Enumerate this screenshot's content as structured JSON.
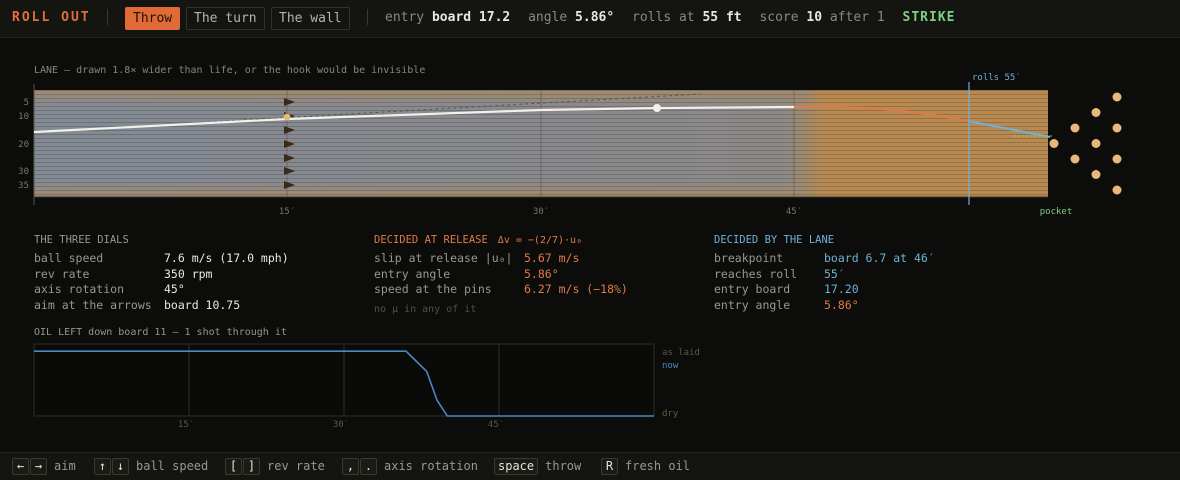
{
  "app": {
    "title": "ROLL OUT"
  },
  "tabs": [
    {
      "label": "Throw",
      "active": true
    },
    {
      "label": "The turn",
      "active": false
    },
    {
      "label": "The wall",
      "active": false
    }
  ],
  "status": {
    "entry_label": "entry",
    "entry_board": "board 17.2",
    "angle_label": "angle",
    "angle": "5.86°",
    "rolls_label": "rolls at",
    "rolls_at": "55 ft",
    "score_label": "score",
    "score": "10",
    "after": "after 1",
    "result": "STRIKE"
  },
  "lane": {
    "caption": "LANE — drawn 1.8× wider than life, or the hook would be invisible",
    "rolls_marker": "rolls  55′",
    "pocket_label": "pocket",
    "board_ticks": [
      "5",
      "10",
      "20",
      "30",
      "35"
    ],
    "ft_ticks": [
      "15′",
      "30′",
      "45′"
    ],
    "colors": {
      "oil": "#7a8aa0",
      "dry": "#b88a52",
      "skid": "#ffffff",
      "hook": "#e07a4a",
      "roll": "#6fb1d8",
      "pins": "#e8b77a"
    }
  },
  "dials": {
    "title": "THE THREE DIALS",
    "rows": [
      {
        "label": "ball speed",
        "value": "7.6 m/s  (17.0 mph)"
      },
      {
        "label": "rev rate",
        "value": "350 rpm"
      },
      {
        "label": "axis rotation",
        "value": "45°"
      },
      {
        "label": "aim at the arrows",
        "value": "board 10.75"
      }
    ]
  },
  "release": {
    "title": "DECIDED AT RELEASE",
    "formula": "Δv = −(2/7)·u₀",
    "rows": [
      {
        "label": "slip at release |u₀|",
        "value": "5.67 m/s"
      },
      {
        "label": "entry angle",
        "value": "5.86°"
      },
      {
        "label": "speed at the pins",
        "value": "6.27 m/s  (−18%)"
      }
    ],
    "note": "no μ in any of it"
  },
  "lane_decided": {
    "title": "DECIDED BY THE LANE",
    "rows": [
      {
        "label": "breakpoint",
        "value": "board 6.7 at 46′"
      },
      {
        "label": "reaches roll",
        "value": "55′"
      },
      {
        "label": "entry board",
        "value": "17.20"
      },
      {
        "label": "entry angle",
        "value": "5.86°"
      }
    ]
  },
  "oil": {
    "caption": "OIL LEFT down board 11 — 1 shot through it",
    "labels": {
      "as_laid": "as laid",
      "now": "now",
      "dry": "dry"
    },
    "ft_ticks": [
      "15′",
      "30′",
      "45′"
    ],
    "profile": [
      [
        0,
        0.9
      ],
      [
        36,
        0.9
      ],
      [
        38,
        0.62
      ],
      [
        39,
        0.22
      ],
      [
        40,
        0.0
      ],
      [
        60,
        0.0
      ]
    ]
  },
  "controls": [
    {
      "keys": [
        "←",
        "→"
      ],
      "label": "aim"
    },
    {
      "keys": [
        "↑",
        "↓"
      ],
      "label": "ball speed"
    },
    {
      "keys": [
        "[",
        "]"
      ],
      "label": "rev rate"
    },
    {
      "keys": [
        ",",
        "."
      ],
      "label": "axis rotation"
    },
    {
      "keys": [
        "space"
      ],
      "label": "throw"
    },
    {
      "keys": [
        "R"
      ],
      "label": "fresh oil"
    }
  ]
}
